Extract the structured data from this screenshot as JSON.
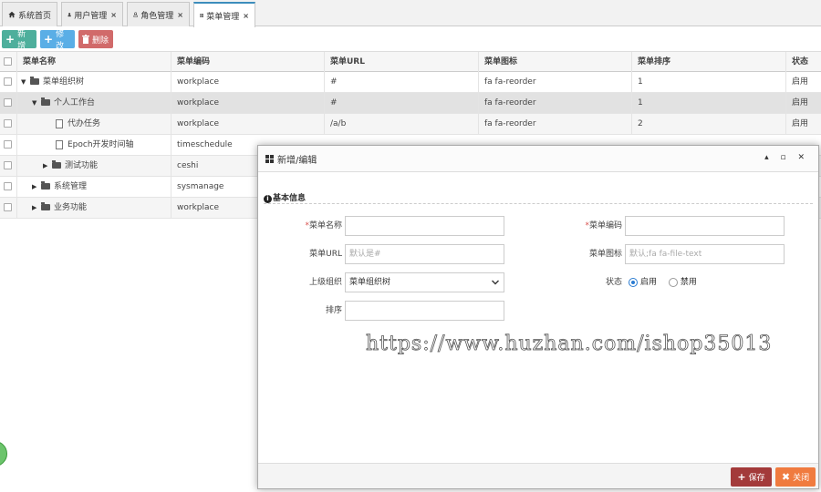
{
  "tabs": [
    {
      "label": "系统首页",
      "icon": "home-icon",
      "closable": false
    },
    {
      "label": "用户管理",
      "icon": "user-icon",
      "closable": true
    },
    {
      "label": "角色管理",
      "icon": "user-outline-icon",
      "closable": true
    },
    {
      "label": "菜单管理",
      "icon": "table-icon",
      "closable": true,
      "active": true
    }
  ],
  "close_glyph": "×",
  "toolbar": {
    "add_label": "新增",
    "edit_label": "修改",
    "delete_label": "删除"
  },
  "table": {
    "headers": [
      "菜单名称",
      "菜单编码",
      "菜单URL",
      "菜单图标",
      "菜单排序",
      "状态"
    ],
    "rows": [
      {
        "name": "菜单组织树",
        "code": "workplace",
        "url": "#",
        "icon": "fa fa-reorder",
        "order": "1",
        "status": "启用",
        "level": 0,
        "node": "folder-open",
        "expanded": true
      },
      {
        "name": "个人工作台",
        "code": "workplace",
        "url": "#",
        "icon": "fa fa-reorder",
        "order": "1",
        "status": "启用",
        "level": 1,
        "node": "folder-open",
        "expanded": true
      },
      {
        "name": "代办任务",
        "code": "workplace",
        "url": "/a/b",
        "icon": "fa fa-reorder",
        "order": "2",
        "status": "启用",
        "level": 2,
        "node": "file"
      },
      {
        "name": "Epoch开发时间轴",
        "code": "timeschedule",
        "url": "",
        "icon": "",
        "order": "",
        "status": "",
        "level": 2,
        "node": "file"
      },
      {
        "name": "测试功能",
        "code": "ceshi",
        "url": "",
        "icon": "",
        "order": "",
        "status": "",
        "level": 1,
        "node": "folder",
        "expanded": false
      },
      {
        "name": "系统管理",
        "code": "sysmanage",
        "url": "",
        "icon": "",
        "order": "",
        "status": "",
        "level": 0,
        "node": "folder",
        "expanded": false
      },
      {
        "name": "业务功能",
        "code": "workplace",
        "url": "",
        "icon": "",
        "order": "",
        "status": "",
        "level": 0,
        "node": "folder",
        "expanded": false
      }
    ]
  },
  "modal": {
    "title": "新增/编辑",
    "header_controls": "▴ ▫ ✕",
    "section_title": "基本信息",
    "fields": {
      "menu_name_label": "菜单名称",
      "menu_name_value": "",
      "menu_code_label": "菜单编码",
      "menu_code_value": "",
      "menu_url_label": "菜单URL",
      "menu_url_placeholder": "默认是#",
      "menu_icon_label": "菜单图标",
      "menu_icon_placeholder": "默认;fa fa-file-text",
      "parent_label": "上级组织",
      "parent_value": "菜单组织树",
      "status_label": "状态",
      "status_options": [
        "启用",
        "禁用"
      ],
      "status_selected": "启用",
      "order_label": "排序",
      "order_value": ""
    },
    "required_mark": "*",
    "watermark": "https://www.huzhan.com/ishop35013",
    "save_label": "保存",
    "close_label": "关闭"
  },
  "colors": {
    "tab_active_border": "#3c8dbc",
    "add": "#4eaf9c",
    "edit": "#5aaee6",
    "delete": "#d16a6a",
    "save": "#a33a3a",
    "close": "#f07b3f",
    "required": "#d9534f"
  }
}
